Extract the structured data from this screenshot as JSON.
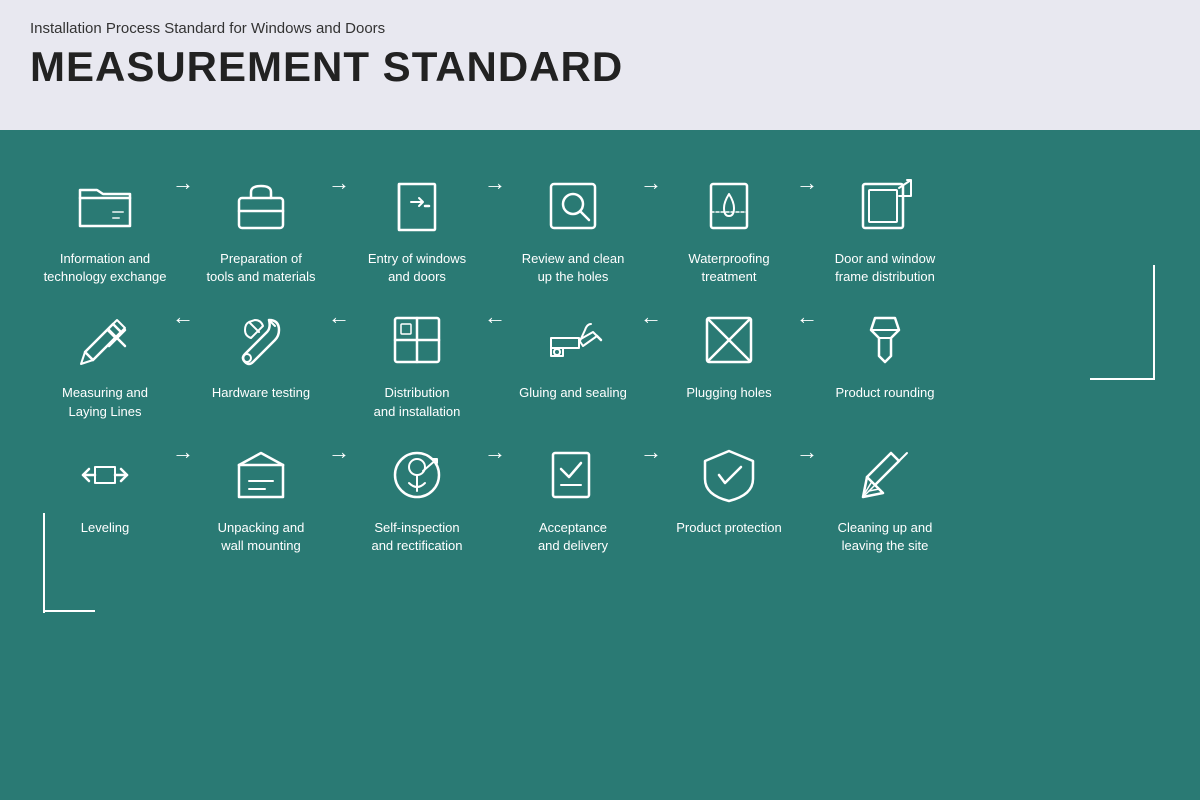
{
  "header": {
    "subtitle": "Installation Process Standard for Windows and Doors",
    "title": "MEASUREMENT STANDARD"
  },
  "row1": [
    {
      "id": "info-exchange",
      "label": "Information and\ntechnology exchange",
      "icon": "folder"
    },
    {
      "id": "tools-prep",
      "label": "Preparation of\ntools and materials",
      "icon": "toolbox"
    },
    {
      "id": "entry-windows",
      "label": "Entry of windows\nand doors",
      "icon": "door"
    },
    {
      "id": "review-holes",
      "label": "Review and clean\nup the holes",
      "icon": "search"
    },
    {
      "id": "waterproofing",
      "label": "Waterproofing\ntreatment",
      "icon": "waterproof"
    },
    {
      "id": "frame-dist",
      "label": "Door and window\nframe distribution",
      "icon": "frame"
    }
  ],
  "row2": [
    {
      "id": "measuring",
      "label": "Measuring and\nLaying Lines",
      "icon": "ruler"
    },
    {
      "id": "hardware",
      "label": "Hardware testing",
      "icon": "wrench"
    },
    {
      "id": "distribution",
      "label": "Distribution\nand installation",
      "icon": "grid"
    },
    {
      "id": "gluing",
      "label": "Gluing and sealing",
      "icon": "glue"
    },
    {
      "id": "plugging",
      "label": "Plugging holes",
      "icon": "plug"
    },
    {
      "id": "rounding",
      "label": "Product rounding",
      "icon": "pin"
    }
  ],
  "row3": [
    {
      "id": "leveling",
      "label": "Leveling",
      "icon": "level"
    },
    {
      "id": "unpacking",
      "label": "Unpacking and\nwall mounting",
      "icon": "unpack"
    },
    {
      "id": "self-inspect",
      "label": "Self-inspection\nand rectification",
      "icon": "inspect"
    },
    {
      "id": "acceptance",
      "label": "Acceptance\nand delivery",
      "icon": "accept"
    },
    {
      "id": "protection",
      "label": "Product protection",
      "icon": "shield"
    },
    {
      "id": "cleanup",
      "label": "Cleaning up and\nleaving the site",
      "icon": "broom"
    }
  ],
  "colors": {
    "background": "#2a7a74",
    "header_bg": "#e8e8f0",
    "white": "#ffffff"
  }
}
